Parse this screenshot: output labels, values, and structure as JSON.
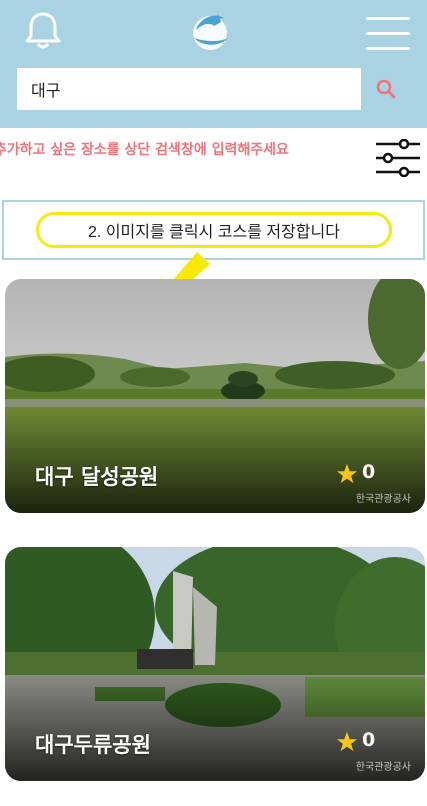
{
  "header": {
    "bell_icon": "bell-icon",
    "logo_icon": "dolphin-logo-icon",
    "menu_icon": "hamburger-menu-icon",
    "accent_color": "#a9d3e2"
  },
  "search": {
    "value": "대구",
    "placeholder": "",
    "icon": "search-icon",
    "icon_color": "#f0757a"
  },
  "hint": {
    "text": "추가하고 싶은 장소를 상단 검색창에 입력해주세요",
    "color": "#f0757a",
    "filter_icon": "sliders-filter-icon"
  },
  "tip": {
    "text": "2. 이미지를 클릭시 코스를 저장합니다",
    "arrow_icon": "yellow-arrow-icon"
  },
  "places": [
    {
      "name": "대구 달성공원",
      "stars": "0",
      "watermark": "한국관광공사",
      "star_icon": "star-icon"
    },
    {
      "name": "대구두류공원",
      "stars": "0",
      "watermark": "한국관광공사",
      "star_icon": "star-icon"
    }
  ]
}
